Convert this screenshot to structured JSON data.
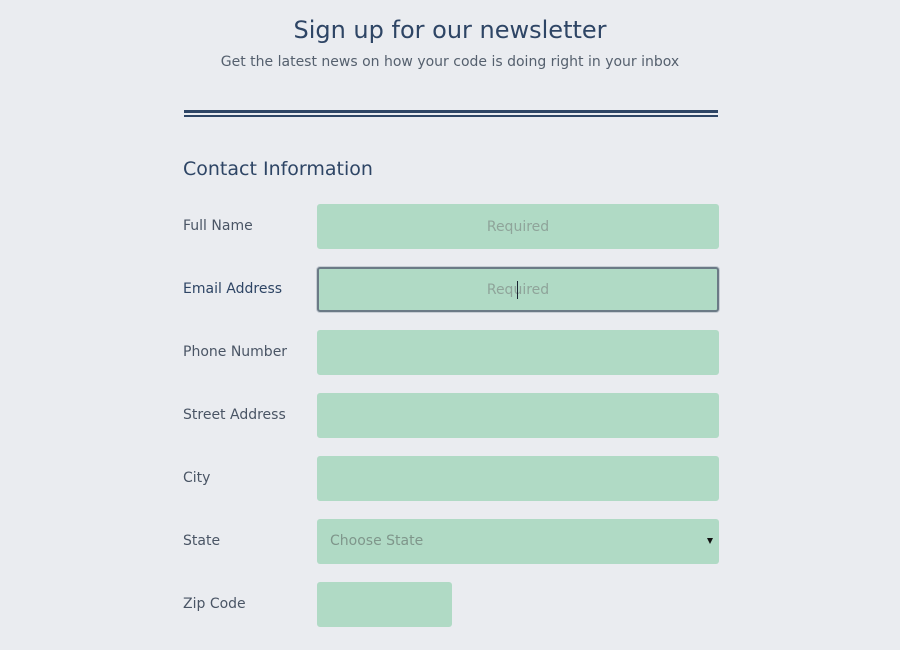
{
  "header": {
    "title": "Sign up for our newsletter",
    "subtitle": "Get the latest news on how your code is doing right in your inbox"
  },
  "section": {
    "title": "Contact Information"
  },
  "form": {
    "full_name": {
      "label": "Full Name",
      "placeholder": "Required",
      "value": ""
    },
    "email": {
      "label": "Email Address",
      "placeholder": "Required",
      "value": ""
    },
    "phone": {
      "label": "Phone Number",
      "placeholder": "",
      "value": ""
    },
    "street": {
      "label": "Street Address",
      "placeholder": "",
      "value": ""
    },
    "city": {
      "label": "City",
      "placeholder": "",
      "value": ""
    },
    "state": {
      "label": "State",
      "selected": "Choose State"
    },
    "zip": {
      "label": "Zip Code",
      "placeholder": "",
      "value": ""
    }
  },
  "colors": {
    "background": "#eaecf0",
    "heading": "#2e4565",
    "field_fill": "#b0dac5",
    "focus_border": "#6b7a86"
  },
  "icons": {
    "select_arrow": "chevron-down-icon"
  }
}
